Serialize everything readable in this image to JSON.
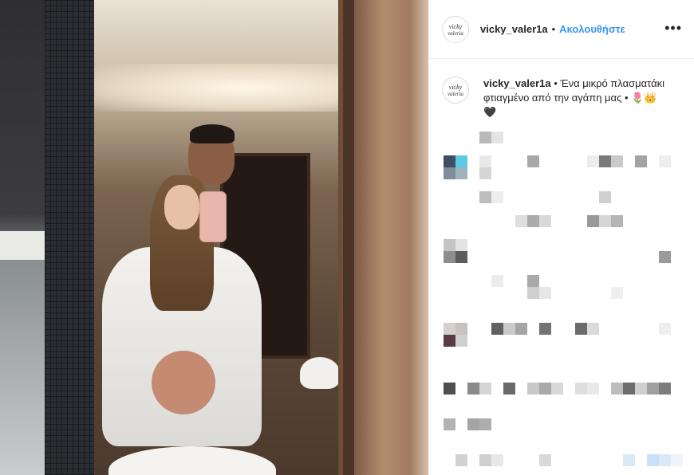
{
  "post": {
    "username": "vicky_valer1a",
    "separator": "•",
    "follow_label": "Ακολουθήστε",
    "more_label": "•••",
    "avatar_text": "vicky valeria",
    "caption": {
      "username": "vicky_valer1a",
      "separator": " • ",
      "text": "Ένα μικρό πλασματάκι φτιαγμένο από την αγάπη μας • 🌷👑🖤"
    }
  },
  "colors": {
    "follow": "#3897f0",
    "text": "#262626",
    "border": "#efefef"
  }
}
